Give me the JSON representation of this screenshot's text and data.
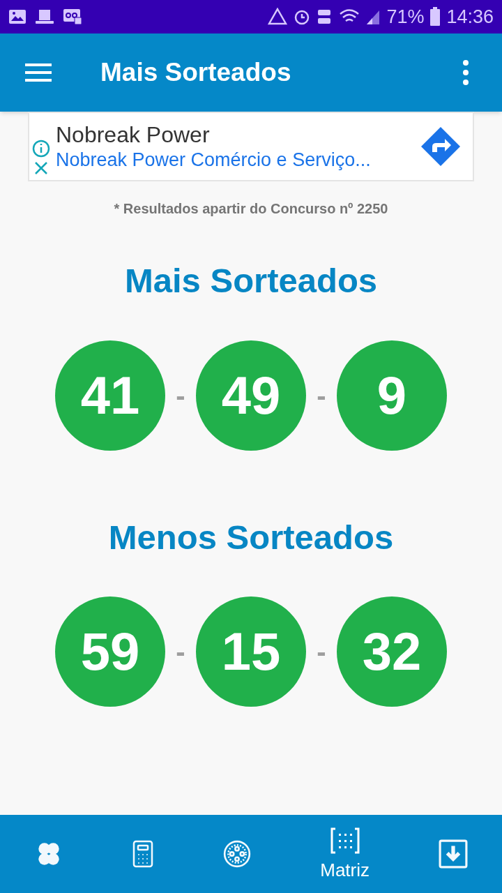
{
  "status_bar": {
    "battery": "71%",
    "time": "14:36"
  },
  "app_bar": {
    "title": "Mais Sorteados"
  },
  "ad": {
    "title": "Nobreak Power",
    "subtitle": "Nobreak Power Comércio e Serviço..."
  },
  "note": "* Resultados apartir do Concurso nº 2250",
  "groups": [
    {
      "title": "Mais Sorteados",
      "separator": "-",
      "numbers": [
        "41",
        "49",
        "9"
      ]
    },
    {
      "title": "Menos Sorteados",
      "separator": "-",
      "numbers": [
        "59",
        "15",
        "32"
      ]
    }
  ],
  "bottom_nav": [
    {
      "kind": "clover",
      "selected": false
    },
    {
      "kind": "calculator",
      "selected": false
    },
    {
      "kind": "wheel",
      "selected": false
    },
    {
      "kind": "matrix",
      "selected": true,
      "label": "Matriz"
    },
    {
      "kind": "download",
      "selected": false
    }
  ]
}
